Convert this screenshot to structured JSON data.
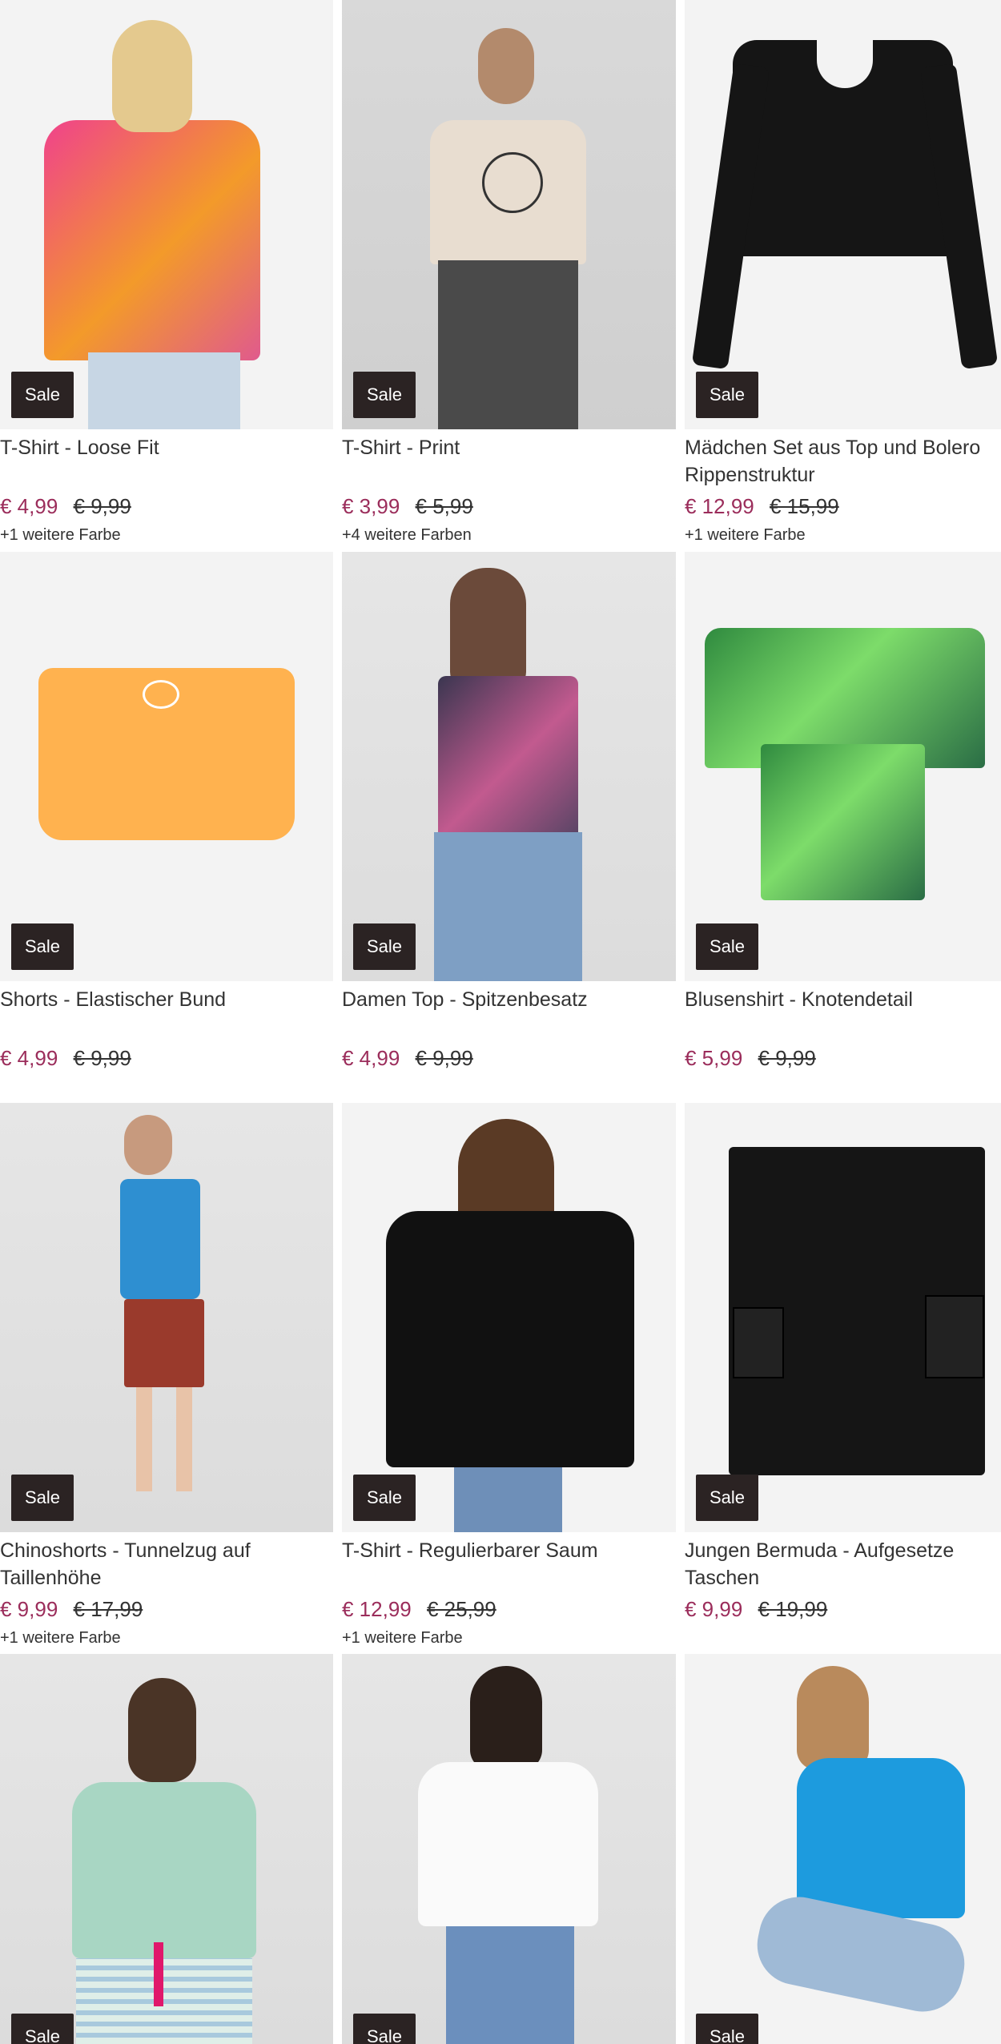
{
  "products": [
    {
      "title": "T-Shirt - Loose Fit",
      "price": "€ 4,99",
      "old_price": "€ 9,99",
      "colors": "+1 weitere Farbe",
      "badge": "Sale"
    },
    {
      "title": "T-Shirt - Print",
      "price": "€ 3,99",
      "old_price": "€ 5,99",
      "colors": "+4 weitere Farben",
      "badge": "Sale"
    },
    {
      "title": "Mädchen Set aus Top und Bolero Rippenstruktur",
      "price": "€ 12,99",
      "old_price": "€ 15,99",
      "colors": "+1 weitere Farbe",
      "badge": "Sale"
    },
    {
      "title": "Shorts - Elastischer Bund",
      "price": "€ 4,99",
      "old_price": "€ 9,99",
      "colors": "",
      "badge": "Sale"
    },
    {
      "title": "Damen Top - Spitzenbesatz",
      "price": "€ 4,99",
      "old_price": "€ 9,99",
      "colors": "",
      "badge": "Sale"
    },
    {
      "title": "Blusenshirt - Knotendetail",
      "price": "€ 5,99",
      "old_price": "€ 9,99",
      "colors": "",
      "badge": "Sale"
    },
    {
      "title": "Chinoshorts - Tunnelzug auf Taillenhöhe",
      "price": "€ 9,99",
      "old_price": "€ 17,99",
      "colors": "+1 weitere Farbe",
      "badge": "Sale"
    },
    {
      "title": "T-Shirt - Regulierbarer Saum",
      "price": "€ 12,99",
      "old_price": "€ 25,99",
      "colors": "+1 weitere Farbe",
      "badge": "Sale"
    },
    {
      "title": "Jungen Bermuda - Aufgesetze Taschen",
      "price": "€ 9,99",
      "old_price": "€ 19,99",
      "colors": "",
      "badge": "Sale"
    },
    {
      "title": "",
      "price": "",
      "old_price": "",
      "colors": "",
      "badge": "Sale"
    },
    {
      "title": "",
      "price": "",
      "old_price": "",
      "colors": "",
      "badge": "Sale"
    },
    {
      "title": "",
      "price": "",
      "old_price": "",
      "colors": "",
      "badge": "Sale"
    }
  ],
  "colors": {
    "price": "#9b2d5b",
    "badge_bg": "#2b2323",
    "text": "#333333"
  }
}
